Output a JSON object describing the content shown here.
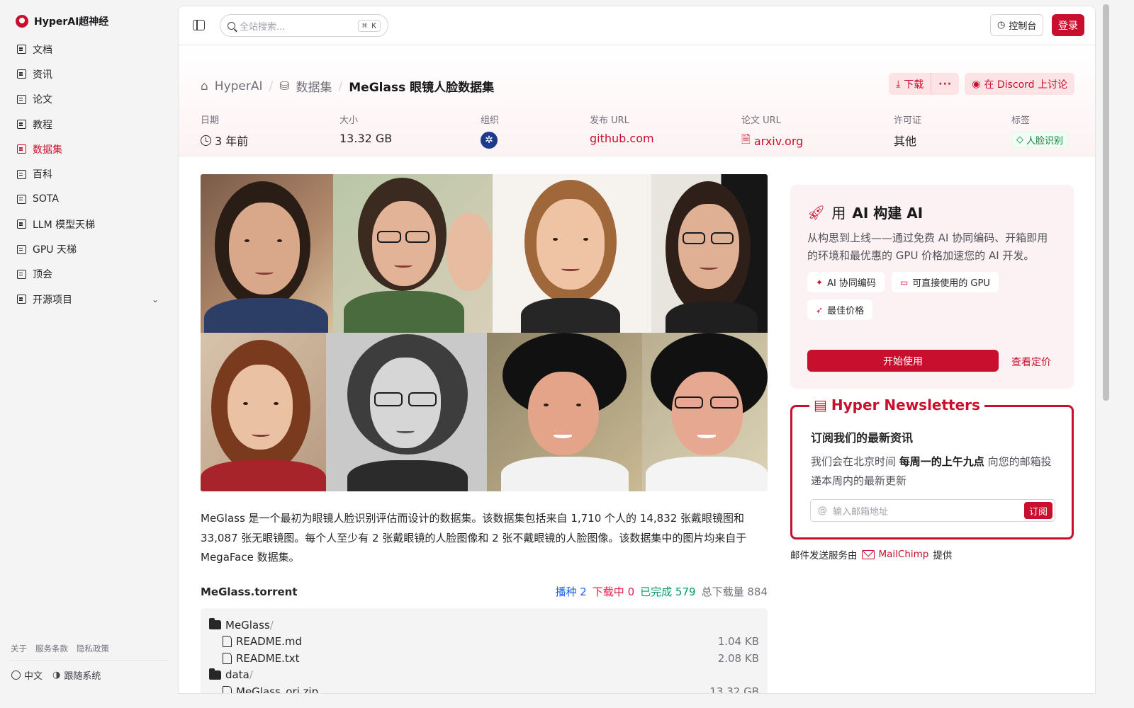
{
  "brand": {
    "name": "HyperAI超神经"
  },
  "sidebar": {
    "items": [
      {
        "label": "文档",
        "icon": "doc-icon"
      },
      {
        "label": "资讯",
        "icon": "news-icon"
      },
      {
        "label": "论文",
        "icon": "paper-icon"
      },
      {
        "label": "教程",
        "icon": "book-icon"
      },
      {
        "label": "数据集",
        "icon": "database-icon",
        "active": true
      },
      {
        "label": "百科",
        "icon": "wiki-icon"
      },
      {
        "label": "SOTA",
        "icon": "bar-chart-icon"
      },
      {
        "label": "LLM 模型天梯",
        "icon": "cpu-icon"
      },
      {
        "label": "GPU 天梯",
        "icon": "monitor-icon"
      },
      {
        "label": "顶会",
        "icon": "calendar-icon"
      },
      {
        "label": "开源项目",
        "icon": "list-icon",
        "expandable": true
      }
    ],
    "footer_links": [
      "关于",
      "服务条款",
      "隐私政策"
    ],
    "language": "中文",
    "theme": "跟随系统"
  },
  "topbar": {
    "search_placeholder": "全站搜索...",
    "search_shortcut": "⌘ K",
    "console_label": "控制台",
    "login_label": "登录"
  },
  "breadcrumb": {
    "home": "HyperAI",
    "section": "数据集",
    "current": "MeGlass 眼镜人脸数据集"
  },
  "actions": {
    "download": "下载",
    "more": "···",
    "discord": "在 Discord 上讨论"
  },
  "meta": {
    "date": {
      "label": "日期",
      "value": "3 年前"
    },
    "size": {
      "label": "大小",
      "value": "13.32 GB"
    },
    "org": {
      "label": "组织",
      "value": ""
    },
    "release_url": {
      "label": "发布 URL",
      "value": "github.com"
    },
    "paper_url": {
      "label": "论文 URL",
      "value": "arxiv.org"
    },
    "license": {
      "label": "许可证",
      "value": "其他"
    },
    "tags": {
      "label": "标签",
      "value": "人脸识别"
    }
  },
  "description": "MeGlass 是一个最初为眼镜人脸识别评估而设计的数据集。该数据集包括来自 1,710 个人的 14,832 张戴眼镜图和 33,087 张无眼镜图。每个人至少有 2 张戴眼镜的人脸图像和 2 张不戴眼镜的人脸图像。该数据集中的图片均来自于 MegaFace 数据集。",
  "torrent": {
    "name": "MeGlass.torrent",
    "seeding_label": "播种",
    "seeding": "2",
    "downloading_label": "下载中",
    "downloading": "0",
    "completed_label": "已完成",
    "completed": "579",
    "total_label": "总下载量",
    "total": "884",
    "files": [
      {
        "type": "folder",
        "name": "MeGlass",
        "suffix": "/",
        "size": "",
        "indent": 0
      },
      {
        "type": "file",
        "name": "README.md",
        "suffix": "",
        "size": "1.04 KB",
        "indent": 1
      },
      {
        "type": "file",
        "name": "README.txt",
        "suffix": "",
        "size": "2.08 KB",
        "indent": 1
      },
      {
        "type": "folder",
        "name": "data",
        "suffix": "/",
        "size": "",
        "indent": 0
      },
      {
        "type": "file",
        "name": "MeGlass_ori.zip",
        "suffix": "",
        "size": "13.32 GB",
        "indent": 1
      }
    ]
  },
  "promo": {
    "title_prefix": "用",
    "title_bold": "AI 构建 AI",
    "text": "从构思到上线——通过免费 AI 协同编码、开箱即用的环境和最优惠的 GPU 价格加速您的 AI 开发。",
    "chips": [
      "AI 协同编码",
      "可直接使用的 GPU",
      "最佳价格"
    ],
    "start": "开始使用",
    "pricing": "查看定价"
  },
  "newsletter": {
    "title": "Hyper Newsletters",
    "heading": "订阅我们的最新资讯",
    "text_before": "我们会在北京时间",
    "text_bold": "每周一的上午九点",
    "text_after": "向您的邮箱投递本周内的最新更新",
    "input_placeholder": "输入邮箱地址",
    "subscribe": "订阅"
  },
  "mail_service": {
    "before": "邮件发送服务由",
    "brand": "MailChimp",
    "after": "提供"
  },
  "colors": {
    "accent": "#c8102e",
    "seeding": "#2563eb",
    "downloading": "#e11d48",
    "completed": "#059669",
    "total": "#71717a"
  }
}
